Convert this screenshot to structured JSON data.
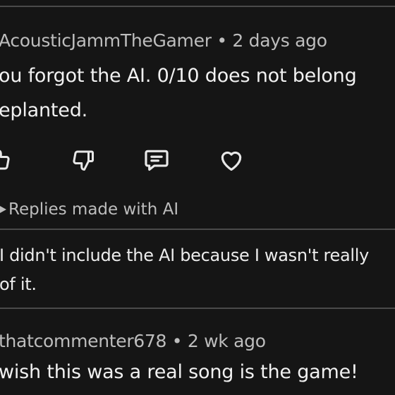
{
  "comment": {
    "username": "AcousticJammTheGamer",
    "age": "2 days ago",
    "text_line1": "ou forgot the AI. 0/10 does not belong",
    "text_line2": "eplanted."
  },
  "actions": {
    "icons": [
      "like-icon",
      "dislike-icon",
      "reply-icon",
      "heart-icon"
    ]
  },
  "replies_toggle": {
    "label": "Replies made with AI"
  },
  "reply": {
    "text_line1": "I didn't include the AI because I wasn't really",
    "text_line2": "of it."
  },
  "next_comment": {
    "username": "thatcommenter678",
    "age": "2 wk ago",
    "text_line1": "wish this was a real song is the game!"
  },
  "colors": {
    "background": "#151515",
    "divider": "#4a4a4a",
    "meta_text": "#bdbdbd",
    "body_text": "#f1f1f1"
  }
}
